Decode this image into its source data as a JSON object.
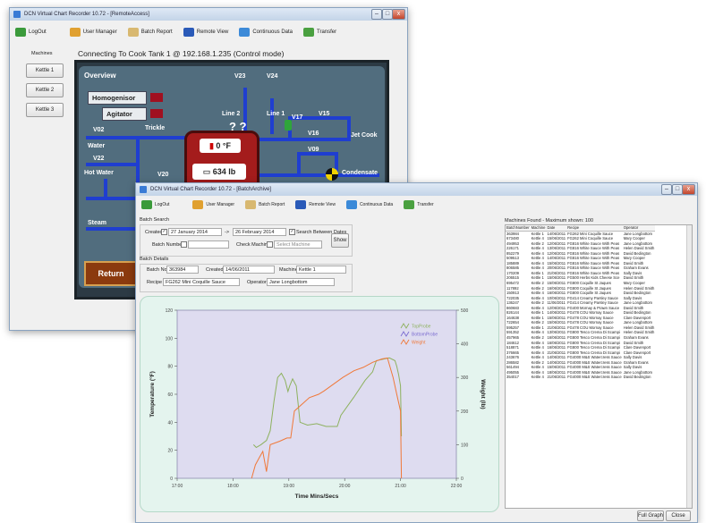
{
  "back_window": {
    "title": "DCN Virtual Chart Recorder 10.72 - [RemoteAccess]",
    "toolbar": {
      "logout": "LogOut",
      "user_manager": "User Manager",
      "batch_report": "Batch Report",
      "remote_view": "Remote View",
      "continuous_data": "Continuous Data",
      "transfer": "Transfer"
    },
    "machines_label": "Machines",
    "machines": [
      "Kettle 1",
      "Kettle 2",
      "Kettle 3"
    ],
    "connection_text": "Connecting To Cook Tank 1 @ 192.168.1.235 (Control mode)",
    "overview_label": "Overview",
    "homogenisor_label": "Homogenisor",
    "agitator_label": "Agitator",
    "trickle_label": "Trickle",
    "water_label": "Water",
    "hot_water_label": "Hot Water",
    "steam_label": "Steam",
    "valves": {
      "v02": "V02",
      "v22": "V22",
      "v20": "V20",
      "v23": "V23",
      "v24": "V24",
      "v17": "V17",
      "v15": "V15",
      "v16": "V16",
      "v09": "V09",
      "v18": "V18"
    },
    "line2_label": "Line 2",
    "line1_label": "Line 1",
    "jet_cook_label": "Jet Cook",
    "condensate_label": "Condensate",
    "temp_readout": "0 °F",
    "weight_readout": "634 lb",
    "return_label": "Return"
  },
  "front_window": {
    "title": "DCN Virtual Chart Recorder 10.72 - [BatchArchive]",
    "toolbar": {
      "logout": "LogOut",
      "user_manager": "User Manager",
      "batch_report": "Batch Report",
      "remote_view": "Remote View",
      "continuous_data": "Continuous Data",
      "transfer": "Transfer"
    },
    "batch_search_label": "Batch Search",
    "created_label": "Created",
    "date_from": "27  January  2014",
    "to_symbol": "->",
    "date_to": "26  February  2014",
    "search_between_dates": "Search Between Dates",
    "batch_number_label": "Batch Number",
    "check_machine_label": "Check Machine",
    "select_machine_placeholder": "Select Machine",
    "show_button": "Show",
    "batch_details_label": "Batch Details",
    "batch_no_label": "Batch No",
    "batch_no_value": "363984",
    "details_created_label": "Created",
    "details_created_value": "14/06/2011",
    "machine_label": "Machine",
    "machine_value": "Kettle 1",
    "recipe_label": "Recipe",
    "recipe_value": "FG262 Mini Coquille Sauce",
    "operator_label": "Operator",
    "operator_value": "Jane Longbottom",
    "machines_found": "Machines Found - Maximum shown: 100",
    "table_headers": [
      "BatchNumber",
      "Machine",
      "Date",
      "Recipe",
      "Operator"
    ],
    "table_rows": [
      [
        "363984",
        "Kettle 1",
        "14/06/2011",
        "FG262 Mini Coquille Sauce",
        "Jane Longbottom"
      ],
      [
        "673480",
        "Kettle 4",
        "15/06/2011",
        "FG262 Mini Coquille Sauce",
        "Mary Cooper"
      ],
      [
        "494953",
        "Kettle 2",
        "12/06/2011",
        "FG816 White Sauce With Peas",
        "Jane Longbottom"
      ],
      [
        "226171",
        "Kettle 4",
        "13/06/2011",
        "FG816 White Sauce With Peas",
        "Helen David Smith"
      ],
      [
        "852279",
        "Kettle 4",
        "12/06/2011",
        "FG816 White Sauce With Peas",
        "David Bedington"
      ],
      [
        "509513",
        "Kettle 4",
        "14/06/2011",
        "FG816 White Sauce With Peas",
        "Mary Cooper"
      ],
      [
        "185889",
        "Kettle 4",
        "15/06/2011",
        "FG816 White Sauce With Peas",
        "David Smith"
      ],
      [
        "806585",
        "Kettle 4",
        "20/06/2011",
        "FG816 White Sauce With Peas",
        "Graham Evans"
      ],
      [
        "170209",
        "Kettle 1",
        "21/06/2011",
        "FG816 White Sauce With Peas",
        "Sally Davis"
      ],
      [
        "206515",
        "Kettle 1",
        "15/06/2011",
        "FG500 Herbs Kids Cheese Sce",
        "David Smith"
      ],
      [
        "695472",
        "Kettle 2",
        "15/06/2011",
        "FG800 Coquille St Jaques",
        "Mary Cooper"
      ],
      [
        "117892",
        "Kettle 2",
        "16/06/2011",
        "FG800 Coquille St Jaques",
        "Helen David Smith"
      ],
      [
        "150913",
        "Kettle 4",
        "16/06/2011",
        "FG800 Coquille St Jaques",
        "David Bedington"
      ],
      [
        "722035",
        "Kettle 4",
        "10/06/2011",
        "FG414 Creamy Parsley Sauce",
        "Sally Davis"
      ],
      [
        "136247",
        "Kettle 2",
        "11/06/2011",
        "FG414 Creamy Parsley Sauce",
        "Jane Longbottom"
      ],
      [
        "860683",
        "Kettle 4",
        "12/06/2011",
        "FG400 Mornay & Prawn Sauce",
        "David Smith"
      ],
      [
        "826144",
        "Kettle 1",
        "14/06/2011",
        "FG478 COU Mornay Sauce",
        "David Bedington"
      ],
      [
        "164638",
        "Kettle 1",
        "15/06/2011",
        "FG478 COU Mornay Sauce",
        "Clare Davenport"
      ],
      [
        "722654",
        "Kettle 2",
        "15/06/2011",
        "FG478 COU Mornay Sauce",
        "Jane Longbottom"
      ],
      [
        "595257",
        "Kettle 1",
        "21/06/2011",
        "FG478 COU Mornay Sauce",
        "Helen David Smith"
      ],
      [
        "591352",
        "Kettle 4",
        "13/06/2011",
        "FG800 Tesco Crema Di Scampi",
        "Helen David Smith"
      ],
      [
        "457965",
        "Kettle 2",
        "16/06/2011",
        "FG800 Tesco Crema Di Scampi",
        "Graham Evans"
      ],
      [
        "184612",
        "Kettle 4",
        "16/06/2011",
        "FG800 Tesco Crema Di Scampi",
        "David Smith"
      ],
      [
        "518871",
        "Kettle 4",
        "16/06/2011",
        "FG800 Tesco Crema Di Scampi",
        "Clare Davenport"
      ],
      [
        "376665",
        "Kettle 4",
        "21/06/2011",
        "FG800 Tesco Crema Di Scampi",
        "Clare Davenport"
      ],
      [
        "243676",
        "Kettle 4",
        "14/06/2011",
        "FG4000 M&S Watercress Sauce",
        "Sally Davis"
      ],
      [
        "286582",
        "Kettle 2",
        "14/06/2011",
        "FG4000 M&S Watercress Sauce",
        "Graham Evans"
      ],
      [
        "561494",
        "Kettle 4",
        "15/06/2011",
        "FG4000 M&S Watercress Sauce",
        "Sally Davis"
      ],
      [
        "495055",
        "Kettle 4",
        "18/06/2011",
        "FG4000 M&S Watercress Sauce",
        "Jane Longbottom"
      ],
      [
        "354017",
        "Kettle 4",
        "21/06/2011",
        "FG4000 M&S Watercress Sauce",
        "David Bedington"
      ]
    ],
    "full_graph_button": "Full Graph",
    "close_button": "Close",
    "colors": {
      "top_probe": "#8db15e",
      "bottom_probe": "#7a6bd0",
      "weight": "#f07838"
    }
  },
  "chart_data": {
    "type": "line",
    "title": "",
    "xlabel": "Time Mins/Secs",
    "ylabel": "Temperature (°F)",
    "y2label": "Weight (lb)",
    "x_ticks": [
      "17:00",
      "18:00",
      "19:00",
      "20:00",
      "21:00",
      "22:00"
    ],
    "y_ticks": [
      0,
      20,
      40,
      60,
      80,
      100,
      120
    ],
    "y2_ticks": [
      0,
      100,
      200,
      300,
      400,
      500
    ],
    "ylim": [
      0,
      120
    ],
    "y2lim": [
      0,
      500
    ],
    "xlim": [
      0,
      300
    ],
    "x_unit_note": "",
    "legend_position": "top-right",
    "series": [
      {
        "name": "TopProbe",
        "axis": "left",
        "color": "#8db15e",
        "points": [
          [
            82,
            24
          ],
          [
            85,
            22
          ],
          [
            90,
            24
          ],
          [
            96,
            27
          ],
          [
            100,
            34
          ],
          [
            104,
            55
          ],
          [
            108,
            72
          ],
          [
            112,
            75
          ],
          [
            116,
            70
          ],
          [
            119,
            62
          ],
          [
            121,
            66
          ],
          [
            124,
            71
          ],
          [
            128,
            66
          ],
          [
            132,
            40
          ],
          [
            140,
            38
          ],
          [
            150,
            39
          ],
          [
            160,
            37
          ],
          [
            172,
            37
          ],
          [
            176,
            45
          ],
          [
            190,
            58
          ],
          [
            202,
            70
          ],
          [
            210,
            76
          ],
          [
            214,
            84
          ],
          [
            228,
            86
          ],
          [
            234,
            84
          ],
          [
            236,
            80
          ],
          [
            238,
            74
          ],
          [
            240,
            66
          ],
          [
            241,
            30
          ]
        ]
      },
      {
        "name": "BottomProbe",
        "axis": "left",
        "color": "#7a6bd0",
        "points": []
      },
      {
        "name": "Weight",
        "axis": "right",
        "color": "#f07838",
        "points": [
          [
            80,
            0
          ],
          [
            84,
            40
          ],
          [
            88,
            60
          ],
          [
            92,
            80
          ],
          [
            96,
            20
          ],
          [
            100,
            100
          ],
          [
            110,
            110
          ],
          [
            118,
            120
          ],
          [
            122,
            120
          ],
          [
            126,
            200
          ],
          [
            134,
            220
          ],
          [
            142,
            240
          ],
          [
            152,
            250
          ],
          [
            158,
            260
          ],
          [
            168,
            280
          ],
          [
            178,
            300
          ],
          [
            190,
            320
          ],
          [
            200,
            330
          ],
          [
            210,
            345
          ],
          [
            220,
            355
          ],
          [
            226,
            358
          ],
          [
            232,
            300
          ],
          [
            236,
            250
          ],
          [
            240,
            200
          ],
          [
            241,
            0
          ]
        ]
      }
    ]
  }
}
